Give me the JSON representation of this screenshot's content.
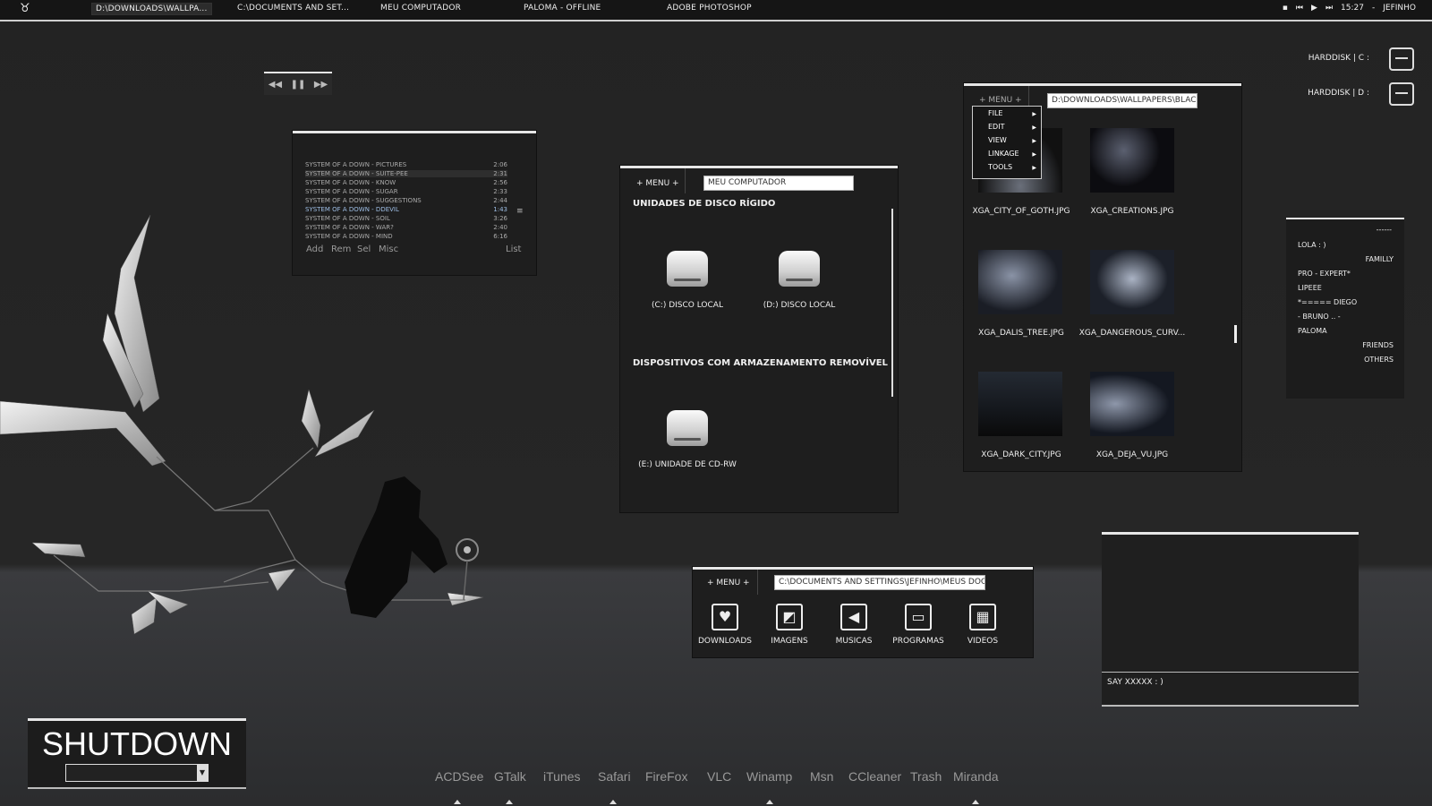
{
  "taskbar": {
    "items": [
      "D:\\DOWNLOADS\\WALLPA...",
      "C:\\DOCUMENTS AND SET...",
      "MEU COMPUTADOR",
      "PALOMA - OFFLINE",
      "ADOBE PHOTOSHOP"
    ],
    "clock": "15:27",
    "user": "JEFINHO",
    "start_icon": "bull-logo-icon"
  },
  "media_controls": {
    "prev_icon": "rewind-icon",
    "pause_icon": "pause-icon",
    "next_icon": "fast-forward-icon"
  },
  "playlist": {
    "tracks": [
      {
        "title": "SYSTEM OF A DOWN - PICTURES",
        "time": "2:06"
      },
      {
        "title": "SYSTEM OF A DOWN - SUITE-PEE",
        "time": "2:31"
      },
      {
        "title": "SYSTEM OF A DOWN - KNOW",
        "time": "2:56"
      },
      {
        "title": "SYSTEM OF A DOWN - SUGAR",
        "time": "2:33"
      },
      {
        "title": "SYSTEM OF A DOWN - SUGGESTIONS",
        "time": "2:44"
      },
      {
        "title": "SYSTEM OF A DOWN - DDEVIL",
        "time": "1:43"
      },
      {
        "title": "SYSTEM OF A DOWN - SOIL",
        "time": "3:26"
      },
      {
        "title": "SYSTEM OF A DOWN - WAR?",
        "time": "2:40"
      },
      {
        "title": "SYSTEM OF A DOWN - MIND",
        "time": "6:16"
      }
    ],
    "buttons": [
      "Add",
      "Rem",
      "Sel",
      "Misc"
    ],
    "list_button": "List"
  },
  "my_computer": {
    "menu": "+ MENU +",
    "address": "MEU COMPUTADOR",
    "section_hdd": "UNIDADES DE DISCO RÍGIDO",
    "section_removable": "DISPOSITIVOS COM ARMAZENAMENTO REMOVÍVEL",
    "drives": [
      "(C:) DISCO LOCAL",
      "(D:) DISCO LOCAL"
    ],
    "removable": [
      "(E:) UNIDADE DE CD-RW"
    ]
  },
  "wallpaper_browser": {
    "menu": "+ MENU +",
    "address": "D:\\DOWNLOADS\\WALLPAPERS\\BLAC",
    "context_menu": [
      "FILE",
      "EDIT",
      "VIEW",
      "LINKAGE",
      "TOOLS"
    ],
    "files": [
      "XGA_CITY_OF_GOTH.JPG",
      "XGA_CREATIONS.JPG",
      "XGA_DALIS_TREE.JPG",
      "XGA_DANGEROUS_CURV...",
      "XGA_DARK_CITY.JPG",
      "XGA_DEJA_VU.JPG"
    ]
  },
  "harddisks": [
    "HARDDISK | C :",
    "HARDDISK | D :"
  ],
  "friends": {
    "header": "------",
    "entries": [
      "LOLA : )",
      "FAMILLY",
      "PRO - EXPERT*",
      "LIPEEE",
      "*===== DIEGO",
      "- BRUNO .. -",
      "PALOMA",
      "FRIENDS",
      "OTHERS"
    ]
  },
  "folders": {
    "menu": "+ MENU +",
    "address": "C:\\DOCUMENTS AND SETTINGS\\JEFINHO\\MEUS DOC",
    "items": [
      {
        "label": "DOWNLOADS",
        "icon": "heart-icon"
      },
      {
        "label": "IMAGENS",
        "icon": "picture-icon"
      },
      {
        "label": "MUSICAS",
        "icon": "speaker-icon"
      },
      {
        "label": "PROGRAMAS",
        "icon": "window-icon"
      },
      {
        "label": "VIDEOS",
        "icon": "clapperboard-icon"
      }
    ]
  },
  "chat": {
    "status": "SAY XXXXX : )"
  },
  "shutdown": {
    "title": "SHUTDOWN"
  },
  "dock": [
    "ACDSee",
    "GTalk",
    "iTunes",
    "Safari",
    "FireFox",
    "VLC",
    "Winamp",
    "Msn",
    "CCleaner",
    "Trash",
    "Miranda"
  ]
}
